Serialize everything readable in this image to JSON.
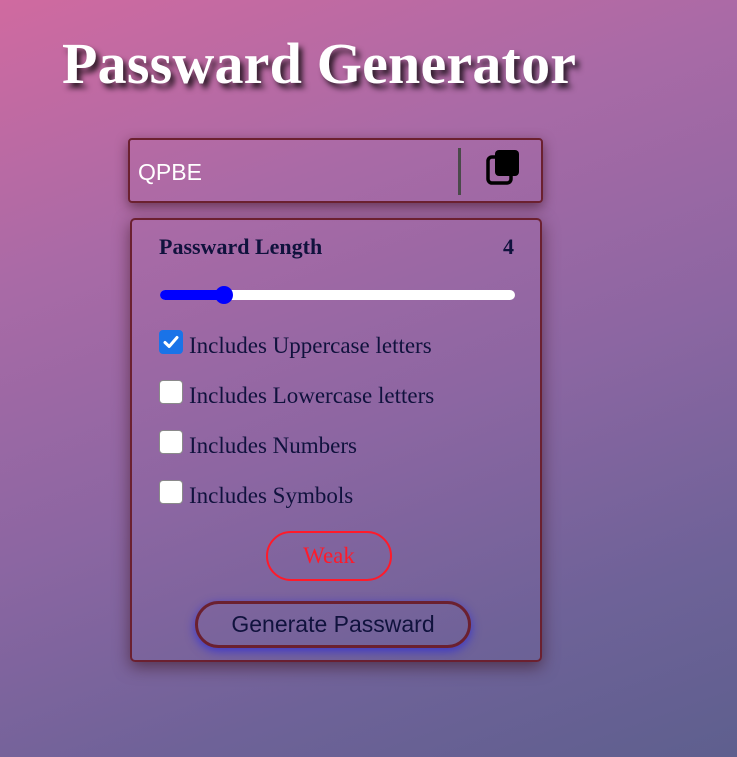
{
  "title": "Passward Generator",
  "display": {
    "value": "QPBE",
    "copy_icon": "copy-icon"
  },
  "length": {
    "label": "Passward Length",
    "value": "4",
    "fraction": 0.18
  },
  "options": [
    {
      "label": "Includes Uppercase letters",
      "checked": true
    },
    {
      "label": "Includes Lowercase letters",
      "checked": false
    },
    {
      "label": "Includes Numbers",
      "checked": false
    },
    {
      "label": "Includes Symbols",
      "checked": false
    }
  ],
  "strength": {
    "label": "Weak",
    "color": "#ff1a2a"
  },
  "generate_button": {
    "label": "Generate Passward"
  },
  "colors": {
    "accent": "#0000ff",
    "checkbox": "#1a73e8",
    "border": "#6b2030",
    "text": "#10123d"
  }
}
